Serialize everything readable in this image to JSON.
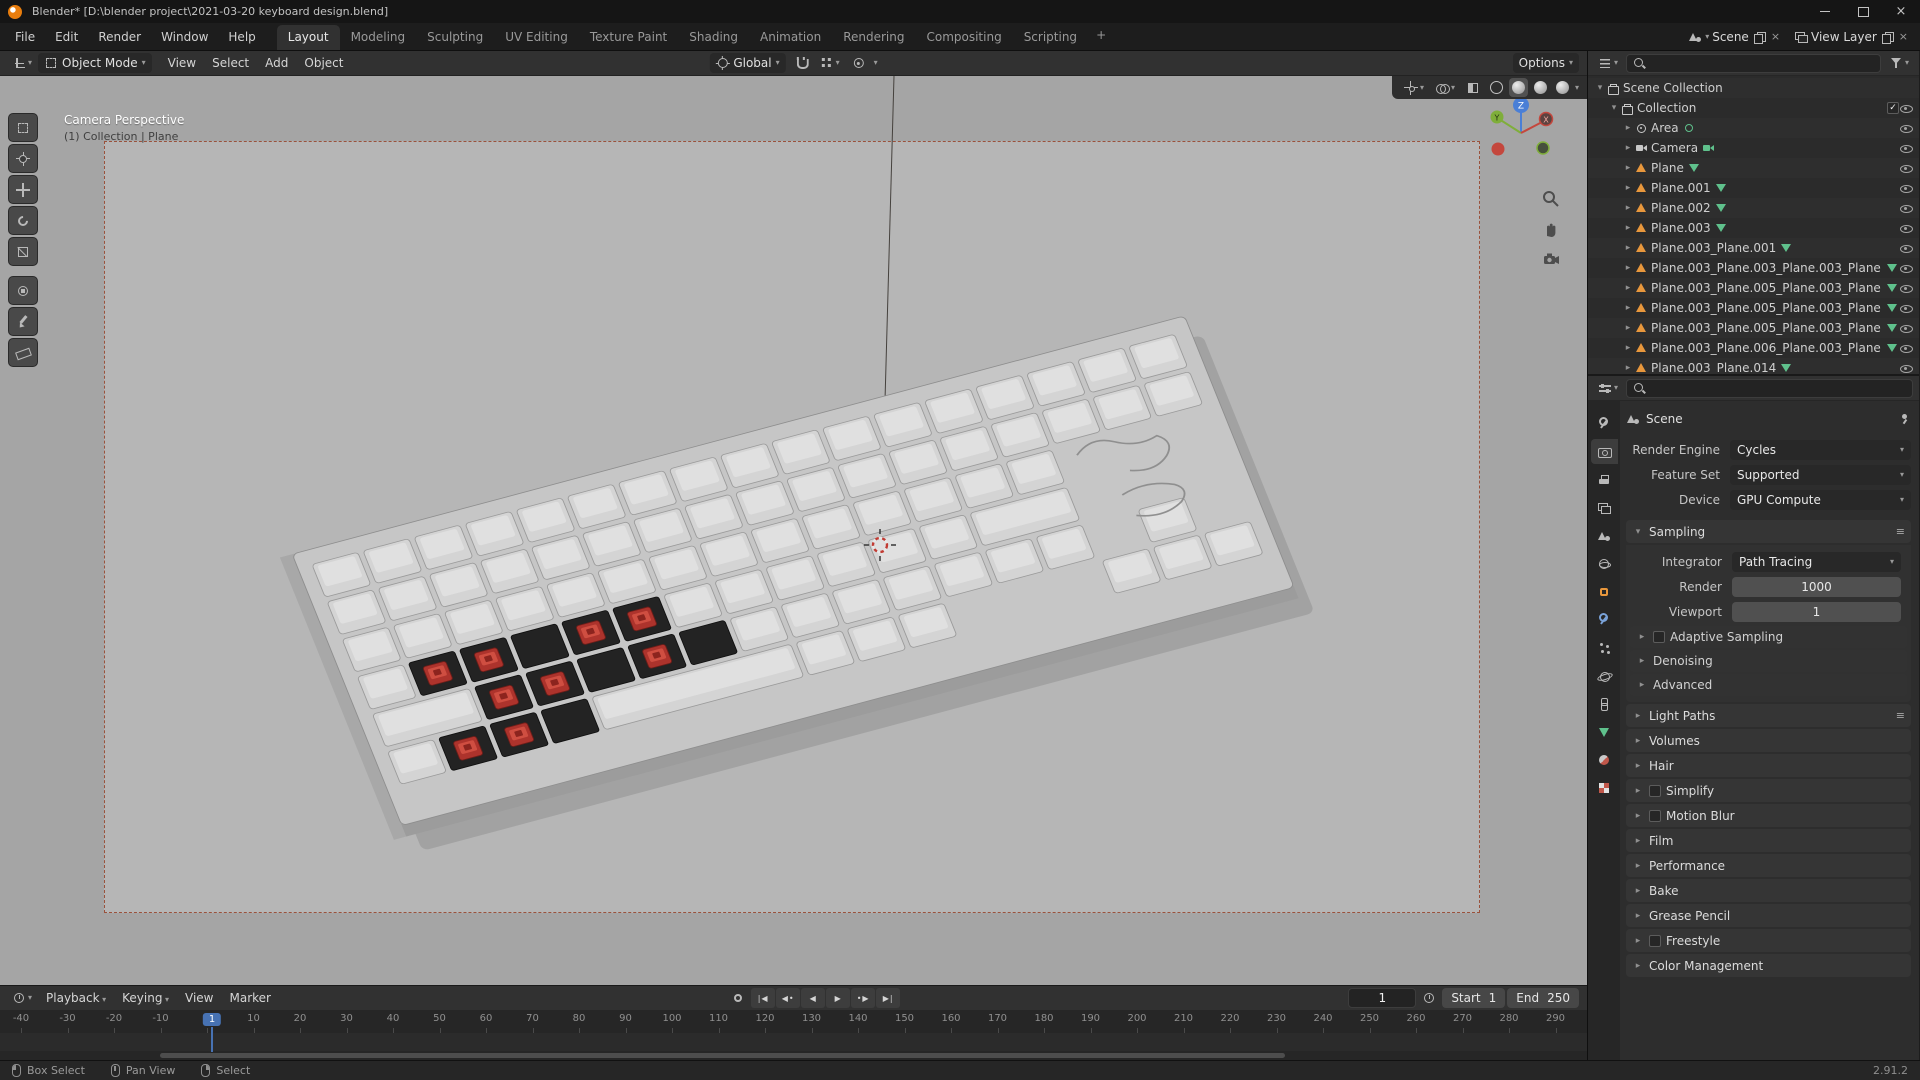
{
  "colors": {
    "accent_blue": "#4772b3",
    "selection_orange": "#e8973c",
    "mesh_data_green": "#5fc18c",
    "switch_red": "#ad332c",
    "keycap": "#d4d4d4",
    "plate_dark": "#232323",
    "viewport_outer": "#a5a5a5",
    "viewport_camera": "#b6b6b6"
  },
  "titlebar": {
    "title": "Blender* [D:\\blender project\\2021-03-20 keyboard design.blend]"
  },
  "topbar": {
    "menus": [
      "File",
      "Edit",
      "Render",
      "Window",
      "Help"
    ],
    "workspaces": [
      "Layout",
      "Modeling",
      "Sculpting",
      "UV Editing",
      "Texture Paint",
      "Shading",
      "Animation",
      "Rendering",
      "Compositing",
      "Scripting"
    ],
    "active_workspace": "Layout",
    "add_workspace_label": "+",
    "scene": {
      "label": "Scene"
    },
    "view_layer": {
      "label": "View Layer"
    }
  },
  "viewport": {
    "header": {
      "mode": "Object Mode",
      "menus": [
        "View",
        "Select",
        "Add",
        "Object"
      ],
      "orientation": "Global",
      "options_label": "Options"
    },
    "overlay": {
      "line1": "Camera Perspective",
      "line2": "(1) Collection | Plane"
    },
    "gizmo_axes": {
      "x": "X",
      "y": "Y",
      "z": "Z"
    },
    "tools": [
      "select-box",
      "cursor",
      "move",
      "rotate",
      "scale",
      "transform",
      "annotate",
      "measure"
    ]
  },
  "outliner": {
    "rows": [
      {
        "depth": 0,
        "caret": "open",
        "icon": "collection",
        "label": "Scene Collection"
      },
      {
        "depth": 1,
        "caret": "open",
        "icon": "collection",
        "label": "Collection",
        "checkbox": true,
        "eye": true
      },
      {
        "depth": 2,
        "caret": "closed",
        "icon": "light",
        "label": "Area",
        "data_icon": "light-data",
        "eye": true
      },
      {
        "depth": 2,
        "caret": "closed",
        "icon": "camera",
        "label": "Camera",
        "data_icon": "camera-data",
        "eye": true
      },
      {
        "depth": 2,
        "caret": "closed",
        "icon": "mesh",
        "label": "Plane",
        "data_icon": "mesh-data",
        "eye": true
      },
      {
        "depth": 2,
        "caret": "closed",
        "icon": "mesh",
        "label": "Plane.001",
        "data_icon": "mesh-data",
        "eye": true
      },
      {
        "depth": 2,
        "caret": "closed",
        "icon": "mesh",
        "label": "Plane.002",
        "data_icon": "mesh-data",
        "eye": true
      },
      {
        "depth": 2,
        "caret": "closed",
        "icon": "mesh",
        "label": "Plane.003",
        "data_icon": "mesh-data",
        "eye": true
      },
      {
        "depth": 2,
        "caret": "closed",
        "icon": "mesh",
        "label": "Plane.003_Plane.001",
        "data_icon": "mesh-data",
        "eye": true
      },
      {
        "depth": 2,
        "caret": "closed",
        "icon": "mesh",
        "label": "Plane.003_Plane.003_Plane.003_Plane.",
        "data_icon": "mesh-data",
        "eye": true
      },
      {
        "depth": 2,
        "caret": "closed",
        "icon": "mesh",
        "label": "Plane.003_Plane.005_Plane.003_Plane.",
        "data_icon": "mesh-data",
        "eye": true
      },
      {
        "depth": 2,
        "caret": "closed",
        "icon": "mesh",
        "label": "Plane.003_Plane.005_Plane.003_Plane.",
        "data_icon": "mesh-data",
        "eye": true
      },
      {
        "depth": 2,
        "caret": "closed",
        "icon": "mesh",
        "label": "Plane.003_Plane.005_Plane.003_Plane.",
        "data_icon": "mesh-data",
        "eye": true
      },
      {
        "depth": 2,
        "caret": "closed",
        "icon": "mesh",
        "label": "Plane.003_Plane.006_Plane.003_Plane.",
        "data_icon": "mesh-data",
        "eye": true
      },
      {
        "depth": 2,
        "caret": "closed",
        "icon": "mesh",
        "label": "Plane.003_Plane.014",
        "data_icon": "mesh-data",
        "eye": true
      }
    ]
  },
  "properties": {
    "tabs": [
      "tool",
      "render",
      "output",
      "view-layer",
      "scene",
      "world",
      "object",
      "modifiers",
      "particles",
      "physics",
      "constraints",
      "object-data",
      "material",
      "texture"
    ],
    "active_tab": "render",
    "breadcrumb": "Scene",
    "fields": [
      {
        "label": "Render Engine",
        "value": "Cycles"
      },
      {
        "label": "Feature Set",
        "value": "Supported"
      },
      {
        "label": "Device",
        "value": "GPU Compute"
      }
    ],
    "sampling": {
      "title": "Sampling",
      "integrator": {
        "label": "Integrator",
        "value": "Path Tracing"
      },
      "samples": [
        {
          "label": "Render",
          "value": "1000"
        },
        {
          "label": "Viewport",
          "value": "1"
        }
      ],
      "subsections": [
        {
          "label": "Adaptive Sampling",
          "checkbox": true
        },
        {
          "label": "Denoising"
        },
        {
          "label": "Advanced"
        }
      ]
    },
    "sections": [
      {
        "label": "Light Paths",
        "menu": true
      },
      {
        "label": "Volumes"
      },
      {
        "label": "Hair"
      },
      {
        "label": "Simplify",
        "checkbox": true
      },
      {
        "label": "Motion Blur",
        "checkbox": true
      },
      {
        "label": "Film"
      },
      {
        "label": "Performance"
      },
      {
        "label": "Bake"
      },
      {
        "label": "Grease Pencil"
      },
      {
        "label": "Freestyle",
        "checkbox": true
      },
      {
        "label": "Color Management"
      }
    ]
  },
  "timeline": {
    "menus": [
      "Playback",
      "Keying",
      "View",
      "Marker"
    ],
    "playback_buttons": [
      "jump-start",
      "prev-keyframe",
      "play-reverse",
      "play",
      "next-keyframe",
      "jump-end"
    ],
    "current_frame": "1",
    "frame_display": "1",
    "start": {
      "label": "Start",
      "value": "1"
    },
    "end": {
      "label": "End",
      "value": "250"
    },
    "ticks": [
      "-40",
      "-30",
      "-20",
      "-10",
      "0",
      "10",
      "20",
      "30",
      "40",
      "50",
      "60",
      "70",
      "80",
      "90",
      "100",
      "110",
      "120",
      "130",
      "140",
      "150",
      "160",
      "170",
      "180",
      "190",
      "200",
      "210",
      "220",
      "230",
      "240",
      "250",
      "260",
      "270",
      "280",
      "290"
    ]
  },
  "statusbar": {
    "hints": [
      {
        "icon": "mouse-left",
        "label": "Box Select"
      },
      {
        "icon": "mouse-middle",
        "label": "Pan View"
      },
      {
        "icon": "mouse-right",
        "label": "Select"
      }
    ],
    "version": "2.91.2"
  }
}
